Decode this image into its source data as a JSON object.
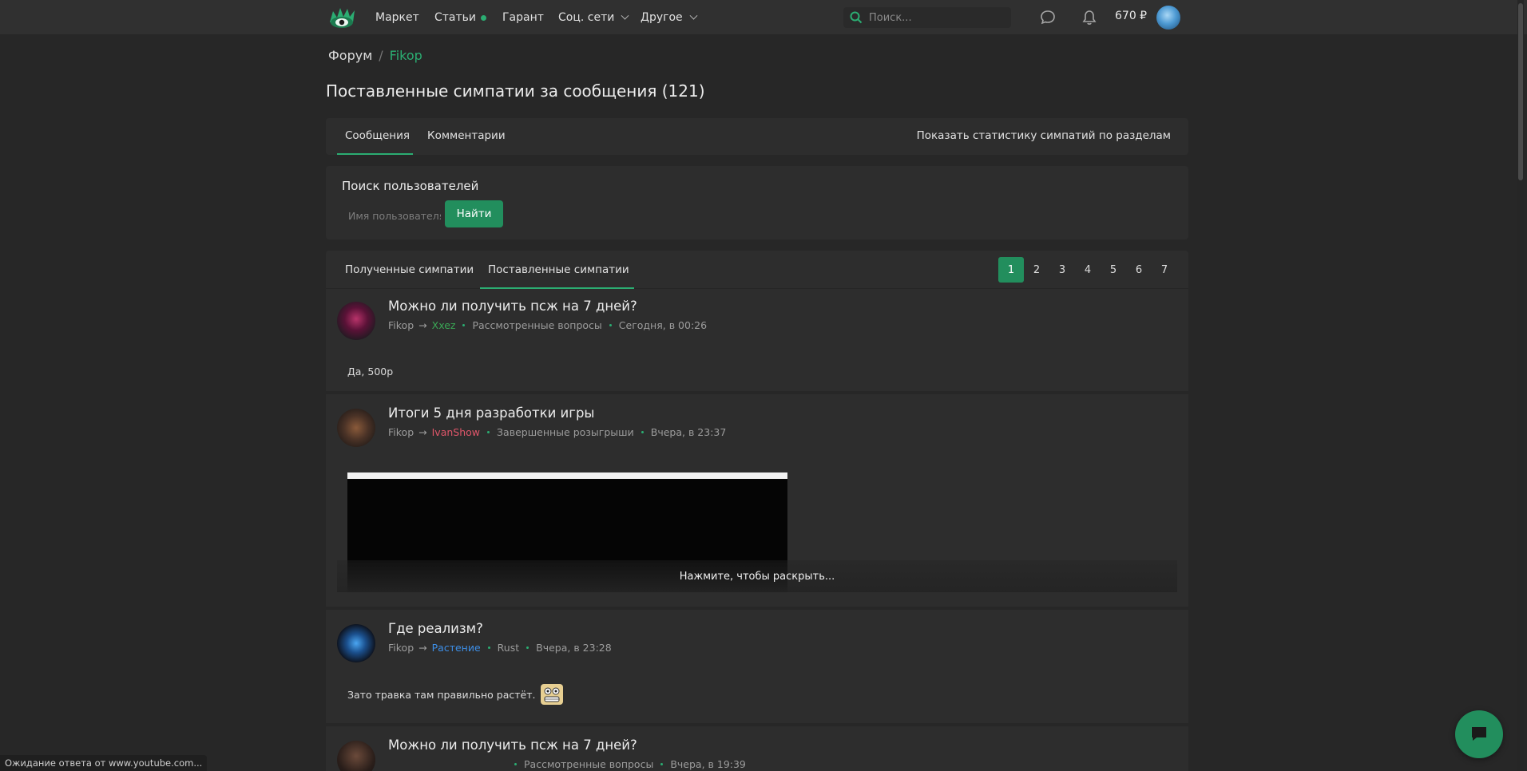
{
  "nav": {
    "items": [
      "Маркет",
      "Статьи",
      "Гарант",
      "Соц. сети",
      "Другое"
    ],
    "search_placeholder": "Поиск...",
    "balance": "670 ₽"
  },
  "breadcrumb": {
    "root": "Форум",
    "separator": "/",
    "current": "Fikop"
  },
  "page_title": "Поставленные симпатии за сообщения (121)",
  "content_tabs": {
    "posts": "Сообщения",
    "comments": "Комментарии",
    "stats_link": "Показать статистику симпатий по разделам"
  },
  "user_search": {
    "title": "Поиск пользователей",
    "placeholder": "Имя пользователя",
    "button": "Найти"
  },
  "like_tabs": {
    "received": "Полученные симпатии",
    "given": "Поставленные симпатии"
  },
  "pagination": [
    "1",
    "2",
    "3",
    "4",
    "5",
    "6",
    "7"
  ],
  "posts": [
    {
      "title": "Можно ли получить псж на 7 дней?",
      "author": "Fikop",
      "arrow": "→",
      "recipient": "Xxez",
      "recipient_color": "#3aa655",
      "section": "Рассмотренные вопросы",
      "time": "Сегодня, в 00:26",
      "text": "Да, 500р"
    },
    {
      "title": "Итоги 5 дня разработки игры",
      "author": "Fikop",
      "arrow": "→",
      "recipient": "IvanShow",
      "recipient_color": "#e0566a",
      "section": "Завершенные розыгрыши",
      "time": "Вчера, в 23:37",
      "expand_label": "Нажмите, чтобы раскрыть..."
    },
    {
      "title": "Где реализм?",
      "author": "Fikop",
      "arrow": "→",
      "recipient": "Растение",
      "recipient_color": "#3d8ee6",
      "section": "Rust",
      "time": "Вчера, в 23:28",
      "text": "Зато травка там правильно растёт."
    },
    {
      "title": "Можно ли получить псж на 7 дней?",
      "section": "Рассмотренные вопросы",
      "time": "Вчера, в 19:39"
    }
  ],
  "status_bar": "Ожидание ответа от www.youtube.com..."
}
